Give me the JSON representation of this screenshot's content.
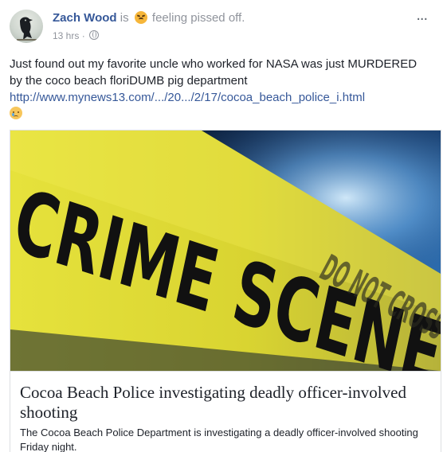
{
  "post": {
    "author": "Zach Wood",
    "is_word": "is",
    "feeling_text": "feeling pissed off.",
    "feeling_icon": "angry-face-icon",
    "timestamp": "13 hrs",
    "separator": "·",
    "privacy_icon": "globe-icon",
    "more_label": "...",
    "text_before_link": "Just found out my favorite uncle who worked for NASA was just MURDERED by the coco beach floriDUMB pig department ",
    "link_text": "http://www.mynews13.com/.../20.../2/17/cocoa_beach_police_i.html",
    "trailing_emoji": "sad-face-icon"
  },
  "link_card": {
    "image_text_main": "CRIME SCENE",
    "image_text_faded": "DO NOT CROSS",
    "title": "Cocoa Beach Police investigating deadly officer-involved shooting",
    "description": "The Cocoa Beach Police Department is investigating a deadly officer-involved shooting Friday night."
  },
  "colors": {
    "author_link": "#365899",
    "tape_yellow": "#e8e23a"
  }
}
